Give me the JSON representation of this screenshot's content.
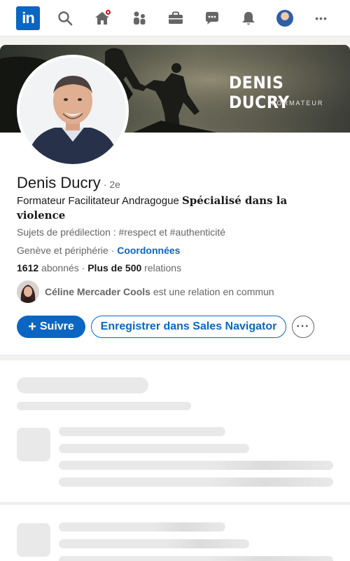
{
  "nav": {
    "logo_text": "in",
    "icons": [
      "linkedin-logo",
      "search-icon",
      "home-icon",
      "people-icon",
      "briefcase-icon",
      "messaging-icon",
      "bell-icon",
      "profile-avatar",
      "more-icon"
    ],
    "more_glyph": "•••"
  },
  "banner": {
    "title": "DENIS DUCRY",
    "subtitle": "FORMATEUR"
  },
  "profile": {
    "name": "Denis Ducry",
    "degree": "· 2e",
    "headline_plain": "Formateur Facilitateur Andragogue ",
    "headline_styled": "𝐒𝐩é𝐜𝐢𝐚𝐥𝐢𝐬é 𝐝𝐚𝐧𝐬 𝐥𝐚 𝐯𝐢𝐨𝐥𝐞𝐧𝐜𝐞",
    "topics": "Sujets de prédilection : #respect et #authenticité",
    "location": "Genève et périphérie · ",
    "contact_link": "Coordonnées",
    "followers_count": "1612",
    "followers_label": " abonnés",
    "connections_prefix": " · ",
    "connections_count": "Plus de 500",
    "connections_label": " relations",
    "mutual_name": "Céline Mercader Cools",
    "mutual_text": " est une relation en commun"
  },
  "actions": {
    "follow_icon": "+",
    "follow_label": "Suivre",
    "sales_label": "Enregistrer dans Sales Navigator",
    "more_glyph": "···"
  },
  "colors": {
    "brand": "#0a66c2",
    "notification": "#cc1016"
  }
}
